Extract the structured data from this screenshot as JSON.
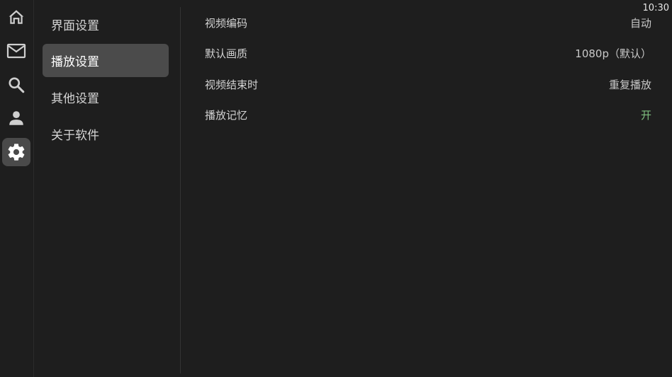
{
  "status_bar": {
    "time": "10:30"
  },
  "rail": {
    "items": [
      {
        "icon": "home-icon"
      },
      {
        "icon": "mail-icon"
      },
      {
        "icon": "search-icon"
      },
      {
        "icon": "user-icon"
      },
      {
        "icon": "gear-icon",
        "active": true
      }
    ]
  },
  "menu": {
    "items": [
      {
        "label": "界面设置"
      },
      {
        "label": "播放设置",
        "active": true
      },
      {
        "label": "其他设置"
      },
      {
        "label": "关于软件"
      }
    ]
  },
  "settings": {
    "rows": [
      {
        "label": "视频编码",
        "value": "自动"
      },
      {
        "label": "默认画质",
        "value": "1080p（默认）"
      },
      {
        "label": "视频结束时",
        "value": "重复播放"
      },
      {
        "label": "播放记忆",
        "value": "开",
        "value_color": "#7fbf7f"
      }
    ]
  },
  "colors": {
    "background": "#1e1e1e",
    "active_item": "#4b4b4b",
    "toggle_on": "#7fbf7f"
  }
}
